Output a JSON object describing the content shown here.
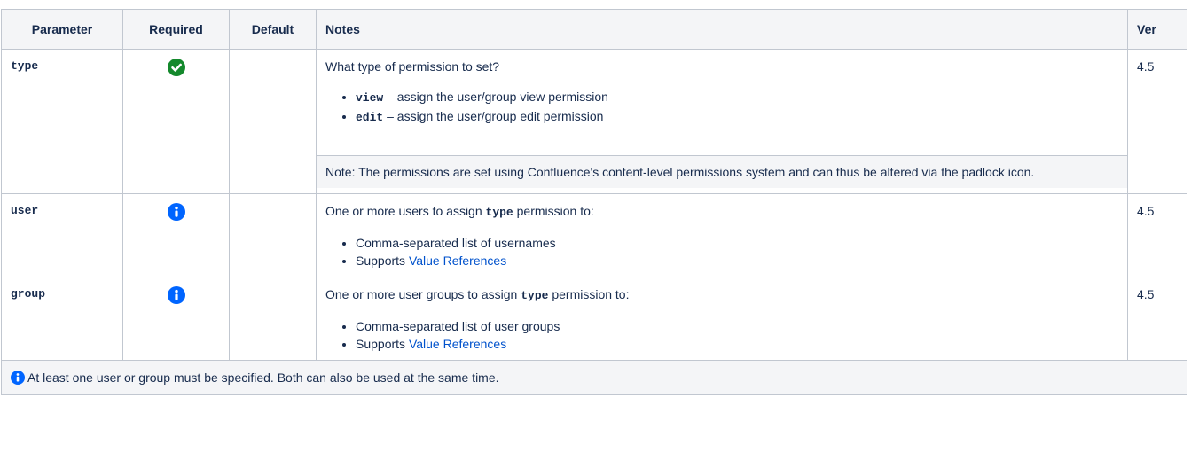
{
  "table": {
    "headers": {
      "parameter": "Parameter",
      "required": "Required",
      "default": "Default",
      "notes": "Notes",
      "ver": "Ver"
    },
    "rows": [
      {
        "parameter": "type",
        "required_icon": "check-circle-icon",
        "default": "",
        "notes_intro": "What type of permission to set?",
        "bullets": [
          {
            "code": "view",
            "text": " – assign the user/group view permission"
          },
          {
            "code": "edit",
            "text": " – assign the user/group edit permission"
          }
        ],
        "note_box": "Note: The permissions are set using Confluence's content-level permissions system and can thus be altered via the padlock icon.",
        "ver": "4.5"
      },
      {
        "parameter": "user",
        "required_icon": "info-icon",
        "default": "",
        "notes_intro_pre": "One or more users to assign ",
        "notes_intro_code": "type",
        "notes_intro_post": " permission to:",
        "bullets": [
          {
            "text": "Comma-separated list of usernames"
          },
          {
            "text_pre": "Supports ",
            "link": "Value References"
          }
        ],
        "ver": "4.5"
      },
      {
        "parameter": "group",
        "required_icon": "info-icon",
        "default": "",
        "notes_intro_pre": "One or more user groups to assign ",
        "notes_intro_code": "type",
        "notes_intro_post": " permission to:",
        "bullets": [
          {
            "text": "Comma-separated list of user groups"
          },
          {
            "text_pre": "Supports ",
            "link": "Value References"
          }
        ],
        "ver": "4.5"
      }
    ],
    "footer": {
      "icon": "info-icon",
      "text": "At least one user or group must be specified. Both can also be used at the same time."
    }
  },
  "colors": {
    "check_green": "#14892c",
    "info_blue": "#0065ff",
    "link_blue": "#0052cc",
    "header_bg": "#f4f5f7",
    "border": "#c1c7d0"
  }
}
